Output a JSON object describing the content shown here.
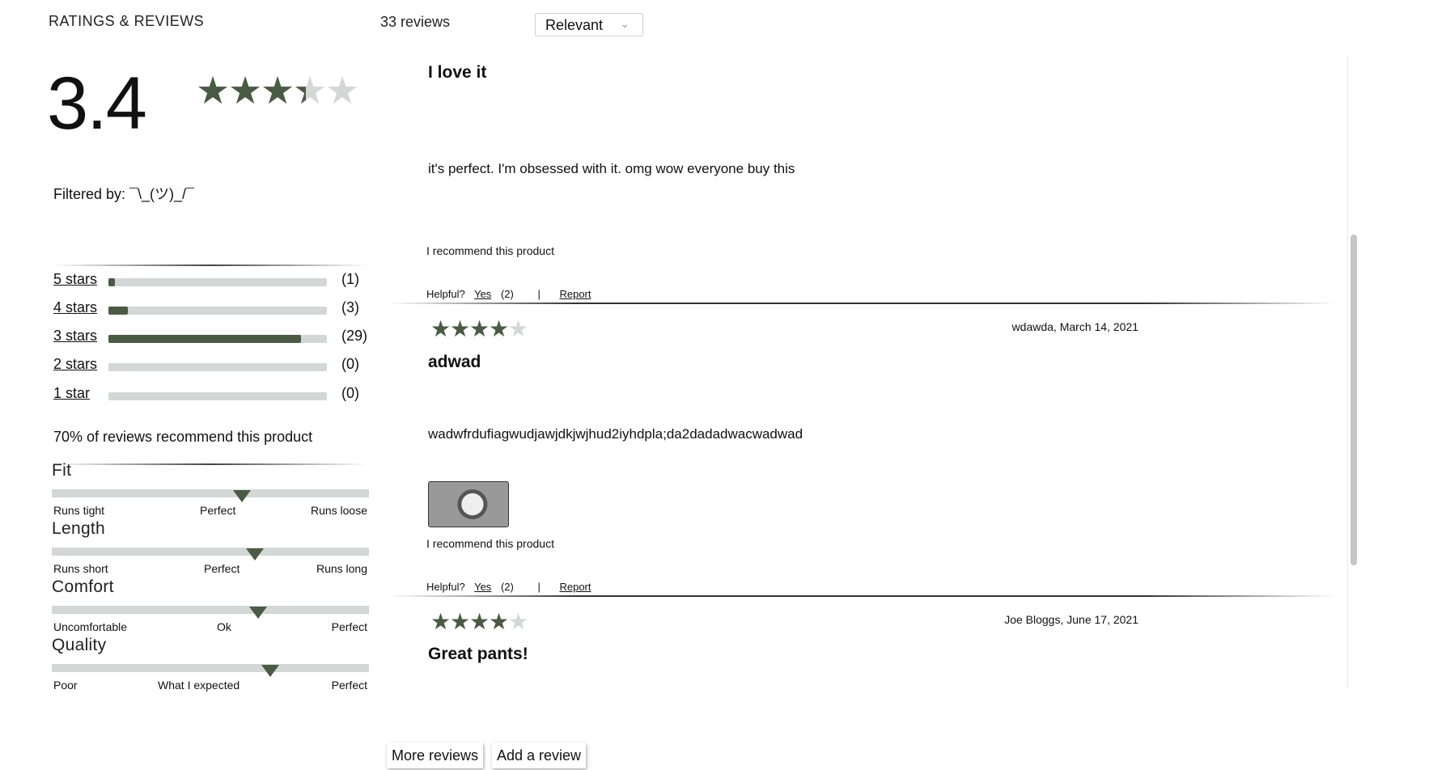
{
  "header": {
    "section_title": "RATINGS & REVIEWS",
    "reviews_count": "33 reviews",
    "sort": {
      "selected": "Relevant",
      "icon": "chevron-down-icon"
    }
  },
  "summary": {
    "average": "3.4",
    "average_value": 3.4,
    "max_stars": 5,
    "filtered_by": "Filtered by: ¯\\_(ツ)_/¯",
    "recommend": "70% of reviews recommend this product"
  },
  "breakdown": [
    {
      "label": "5 stars",
      "count": "(1)",
      "fraction": 0.03
    },
    {
      "label": "4 stars",
      "count": "(3)",
      "fraction": 0.09
    },
    {
      "label": "3 stars",
      "count": "(29)",
      "fraction": 0.88
    },
    {
      "label": "2 stars",
      "count": "(0)",
      "fraction": 0
    },
    {
      "label": "1 star",
      "count": "(0)",
      "fraction": 0
    }
  ],
  "characteristics": [
    {
      "name": "Fit",
      "low": "Runs tight",
      "mid": "Perfect",
      "high": "Runs loose",
      "value": 0.6
    },
    {
      "name": "Length",
      "low": "Runs short",
      "mid": "Perfect",
      "high": "Runs long",
      "value": 0.64
    },
    {
      "name": "Comfort",
      "low": "Uncomfortable",
      "mid": "Ok",
      "high": "Perfect",
      "value": 0.65
    },
    {
      "name": "Quality",
      "low": "Poor",
      "mid": "What I expected",
      "high": "Perfect",
      "value": 0.69
    }
  ],
  "reviews": [
    {
      "title": "I love it",
      "body": "it's perfect. I'm obsessed with it. omg wow everyone buy this",
      "recommend": "I recommend this product",
      "helpful_label": "Helpful?",
      "yes_label": "Yes",
      "yes_count": "(2)",
      "separator": "|",
      "report_label": "Report"
    },
    {
      "rating": 4,
      "meta": "wdawda, March 14, 2021",
      "title": "adwad",
      "body": "wadwfrdufiagwudjawjdkjwjhud2iyhdpla;da2dadadwacwadwad",
      "recommend": "I recommend this product",
      "helpful_label": "Helpful?",
      "yes_label": "Yes",
      "yes_count": "(2)",
      "separator": "|",
      "report_label": "Report"
    },
    {
      "rating": 4,
      "meta": "Joe Bloggs, June 17, 2021",
      "title": "Great pants!"
    }
  ],
  "buttons": {
    "more_reviews": "More reviews",
    "add_review": "Add a review"
  },
  "colors": {
    "star_fill": "#4a5a45",
    "star_empty": "#d3d7d6",
    "bar_fill": "#4a5a45",
    "bar_track": "#d3d7d6"
  }
}
